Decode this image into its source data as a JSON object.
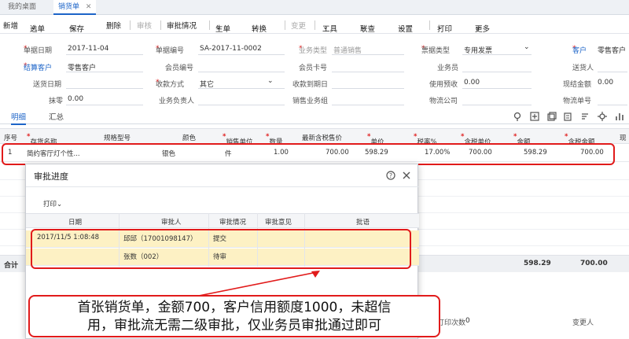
{
  "tabs": {
    "home": "我的桌面",
    "sales": "销货单",
    "close": "✕"
  },
  "toolbar": {
    "new": "新增",
    "select": "选单",
    "save": "保存",
    "delete": "删除",
    "audit": "审核",
    "approval_status": "审批情况",
    "generate": "生单",
    "convert": "转换",
    "change": "变更",
    "tools": "工具",
    "query": "联查",
    "settings": "设置",
    "print": "打印",
    "more": "更多"
  },
  "form": {
    "date_label": "单据日期",
    "date_value": "2017-11-04",
    "no_label": "单据编号",
    "no_value": "SA-2017-11-0002",
    "biztype_label": "业务类型",
    "biztype_value": "普通销售",
    "billtype_label": "票据类型",
    "billtype_value": "专用发票",
    "customer_label": "客户",
    "customer_value": "零售客户",
    "settle_label": "结算客户",
    "settle_value": "零售客户",
    "member_label": "会员编号",
    "membercard_label": "会员卡号",
    "salesman_label": "业务员",
    "sender_label": "送货人",
    "delivery_label": "送货日期",
    "paymode_label": "收款方式",
    "paymode_value": "其它",
    "duedate_label": "收款到期日",
    "prepaid_label": "使用预收",
    "prepaid_value": "0.00",
    "cash_label": "现结金额",
    "cash_value": "0.00",
    "discount_label": "抹零",
    "discount_value": "0.00",
    "owner_label": "业务负责人",
    "salesgroup_label": "销售业务组",
    "logistics_label": "物流公司",
    "logisticsno_label": "物流单号"
  },
  "detail_tabs": {
    "detail": "明细",
    "summary": "汇总"
  },
  "grid": {
    "headers": [
      "序号",
      "存货名称",
      "规格型号",
      "颜色",
      "销售单位",
      "数量",
      "最新含税售价",
      "单价",
      "税率%",
      "含税单价",
      "金额",
      "含税金额",
      "现"
    ],
    "row": [
      "1",
      "简约客厅灯个性...",
      "",
      "银色",
      "件",
      "1.00",
      "700.00",
      "598.29",
      "17.00%",
      "700.00",
      "598.29",
      "700.00"
    ],
    "total_label": "合计",
    "total_amount": "598.29",
    "total_tax_amount": "700.00"
  },
  "modal": {
    "title": "审批进度",
    "print": "打印",
    "headers": [
      "日期",
      "审批人",
      "审批情况",
      "审批意见",
      "批语"
    ],
    "rows": [
      [
        "2017/11/5 1:08:48",
        "邱邱（17001098147）",
        "提交",
        "",
        ""
      ],
      [
        "",
        "张数（002）",
        "待审",
        "",
        ""
      ]
    ]
  },
  "footer": {
    "print_count_label": "打印次数",
    "print_count_value": "0",
    "changer_label": "变更人"
  },
  "callout": {
    "line1": "首张销货单，金额700，客户信用额度1000，未超信",
    "line2": "用，审批流无需二级审批，仅业务员审批通过即可"
  },
  "colors": {
    "accent": "#1c64c8",
    "highlight": "#e11b1b",
    "row_highlight": "#fdf1c4"
  }
}
